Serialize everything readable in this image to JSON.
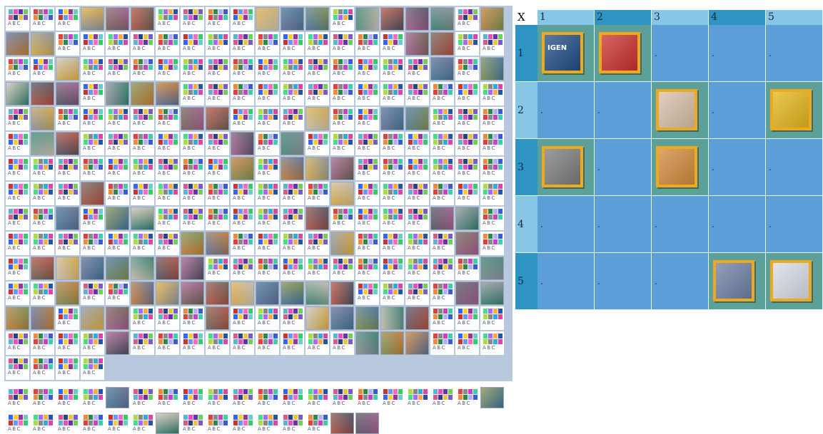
{
  "palette_sets": [
    [
      "#5cb3d6",
      "#e84fc4",
      "#6d2fb0",
      "#6bd15a",
      "#d85a8c",
      "#2c3e8e",
      "#e9c53d",
      "#7b59c7"
    ],
    [
      "#3a5bd6",
      "#e43e3e",
      "#8a8a8a",
      "#c83fd0",
      "#3cd0a8",
      "#f08a3a",
      "#2a8a4a",
      "#b0b0ff"
    ],
    [
      "#ff66cc",
      "#33cc66",
      "#3366ff",
      "#ffcc33",
      "#993399",
      "#66cccc",
      "#cc3333",
      "#6699ff"
    ],
    [
      "#888888",
      "#33aadd",
      "#dd44aa",
      "#44dd88",
      "#aa66ff",
      "#ffaa44",
      "#2255aa",
      "#aadd44"
    ]
  ],
  "template_label": "ABC",
  "picker_grid": "TTTPPPTTTTPPPTPPPPTPPPTTTTTTTTTTTTTTPPTTTTPTTTTTTTTTTTTTTPTPPPPTPPPTTTTTTTTTTTTTTPTTTTTPPTTTPTTPPTTTTPPTTTTTTPTPTTTTTTTTTTTTTTTTTPTPPPTTTTTTTTTPTTTTTTTTTPTTTTTTTTPTPPTTTTTTPTTTTPPTTTTTTTTPPTTTTPTTTTPTTPPPPPPPTTTTTTTTTTTPTTPTTPPPPPPPPPTTTTPPPPTPPTTTPTTTPPPPPTTTTTTTPTTTTTTTTTPPPTTTTTTT",
  "picker_tail": "TTTTPTTTTTTTTTTTTTTPTTTTTTPTTTTTTPP",
  "thumb_colors": [
    "#8a8f96",
    "#6b5a4e",
    "#b04a3a",
    "#d9a83c",
    "#3f6f95",
    "#7a8a4a",
    "#c8c0b0",
    "#4a4a5a",
    "#a05a8a",
    "#2f7a6a",
    "#c07830",
    "#5a6a90"
  ],
  "board": {
    "corner": "X",
    "columns": [
      "1",
      "2",
      "3",
      "4",
      "5"
    ],
    "rows": [
      "1",
      "2",
      "3",
      "4",
      "5"
    ],
    "empty_mark": ".",
    "cells": [
      [
        {
          "tile": "IGEN",
          "color": "#1f4c86"
        },
        {
          "tile": "",
          "color": "#c9302c"
        },
        null,
        null,
        null
      ],
      [
        null,
        null,
        {
          "tile": "",
          "color": "#d6c0a8"
        },
        null,
        {
          "tile": "",
          "color": "#e3b51b"
        }
      ],
      [
        {
          "tile": "",
          "color": "#7c7c7c"
        },
        null,
        {
          "tile": "",
          "color": "#d08a3a"
        },
        null,
        null
      ],
      [
        null,
        null,
        null,
        null,
        null
      ],
      [
        null,
        null,
        null,
        {
          "tile": "",
          "color": "#6d7fa3"
        },
        {
          "tile": "",
          "color": "#d8dce6"
        }
      ]
    ]
  }
}
